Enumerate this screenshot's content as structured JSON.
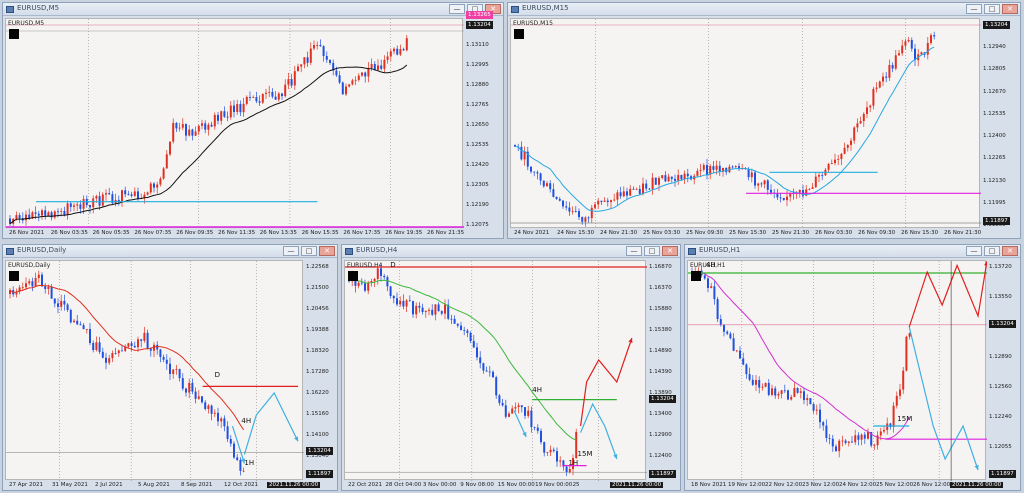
{
  "windows": [
    {
      "key": "m5",
      "title": "EURUSD,M5",
      "symbol_label": "EURUSD,M5",
      "price_axis": [
        "1.13265",
        "1.13110",
        "1.12995",
        "1.12880",
        "1.12765",
        "1.12650",
        "1.12535",
        "1.12420",
        "1.12305",
        "1.12190",
        "1.12075"
      ],
      "price_tags": [
        {
          "text": "1.13204",
          "style": "dark"
        },
        {
          "text": "1.13265",
          "style": "pink"
        }
      ],
      "time_axis": [
        "26 Nov 2021",
        "26 Nov 03:35",
        "26 Nov 05:35",
        "26 Nov 07:35",
        "26 Nov 09:35",
        "26 Nov 11:35",
        "26 Nov 13:35",
        "26 Nov 15:35",
        "26 Nov 17:35",
        "26 Nov 19:35",
        "26 Nov 21:35"
      ],
      "annotations": []
    },
    {
      "key": "m15",
      "title": "EURUSD,M15",
      "symbol_label": "EURUSD,M15",
      "price_axis": [
        "1.13075",
        "1.12940",
        "1.12805",
        "1.12670",
        "1.12535",
        "1.12400",
        "1.12265",
        "1.12130",
        "1.11995",
        "1.11860"
      ],
      "price_tags": [
        {
          "text": "1.13204",
          "style": "dark"
        },
        {
          "text": "1.11897",
          "style": "dark"
        }
      ],
      "time_axis": [
        "24 Nov 2021",
        "24 Nov 15:30",
        "24 Nov 21:30",
        "25 Nov 03:30",
        "25 Nov 09:30",
        "25 Nov 15:30",
        "25 Nov 21:30",
        "26 Nov 03:30",
        "26 Nov 09:30",
        "26 Nov 15:30",
        "26 Nov 21:30"
      ],
      "annotations": []
    },
    {
      "key": "daily",
      "title": "EURUSD,Daily",
      "symbol_label": "EURUSD,Daily",
      "price_axis": [
        "1.22568",
        "1.21500",
        "1.20456",
        "1.19388",
        "1.18320",
        "1.17280",
        "1.16220",
        "1.15160",
        "1.14100",
        "1.13040",
        "1.11980"
      ],
      "price_tags": [
        {
          "text": "1.13204",
          "style": "dark"
        },
        {
          "text": "1.11897",
          "style": "dark"
        }
      ],
      "time_axis": [
        "27 Apr 2021",
        "31 May 2021",
        "2 Jul 2021",
        "5 Aug 2021",
        "8 Sep 2021",
        "12 Oct 2021",
        "2021.11.26 00:00"
      ],
      "annotations": [
        "D",
        "4H",
        "1H"
      ]
    },
    {
      "key": "h4",
      "title": "EURUSD,H4",
      "symbol_label": "EURUSD,H4",
      "price_axis": [
        "1.16870",
        "1.16370",
        "1.15880",
        "1.15380",
        "1.14890",
        "1.14390",
        "1.13890",
        "1.13400",
        "1.12900",
        "1.12400",
        "1.11897"
      ],
      "price_tags": [
        {
          "text": "1.13204",
          "style": "dark"
        },
        {
          "text": "1.11897",
          "style": "dark"
        }
      ],
      "time_axis": [
        "22 Oct 2021",
        "28 Oct 04:00",
        "3 Nov 00:00",
        "9 Nov 08:00",
        "15 Nov 00:00",
        "19 Nov 00:00",
        "25",
        "2021.11.26 00:00"
      ],
      "annotations": [
        "D",
        "4H",
        "15M",
        "1H"
      ]
    },
    {
      "key": "h1",
      "title": "EURUSD,H1",
      "symbol_label": "EURUSD,H1",
      "price_axis": [
        "1.13720",
        "1.13550",
        "1.13204",
        "1.12890",
        "1.12560",
        "1.12240",
        "1.12055",
        "1.11897"
      ],
      "price_tags": [
        {
          "text": "1.13204",
          "style": "dark"
        },
        {
          "text": "1.11897",
          "style": "dark"
        }
      ],
      "time_axis": [
        "18 Nov 2021",
        "19 Nov 12:00",
        "22 Nov 12:00",
        "23 Nov 12:00",
        "24 Nov 12:00",
        "25 Nov 12:00",
        "26 Nov 12:00",
        "2021.11.26 00:00"
      ],
      "annotations": [
        "4H",
        "15M"
      ]
    }
  ],
  "window_buttons": {
    "minimize": "—",
    "maximize": "□",
    "close": "✕"
  },
  "colors": {
    "bull_candle": "#e03020",
    "bear_candle": "#2050e0",
    "moving_average_dark": "#111111",
    "moving_average_blue": "#29a8e0",
    "moving_average_red": "#e03020",
    "moving_average_green": "#3cb83c",
    "moving_average_magenta": "#d030d0",
    "level_cyan": "#20b0e0",
    "level_magenta": "#e020e0",
    "level_red": "#e02020",
    "level_green": "#30b030",
    "scenario_up_arrow": "#e02020",
    "scenario_down_arrow": "#40b0e0"
  }
}
